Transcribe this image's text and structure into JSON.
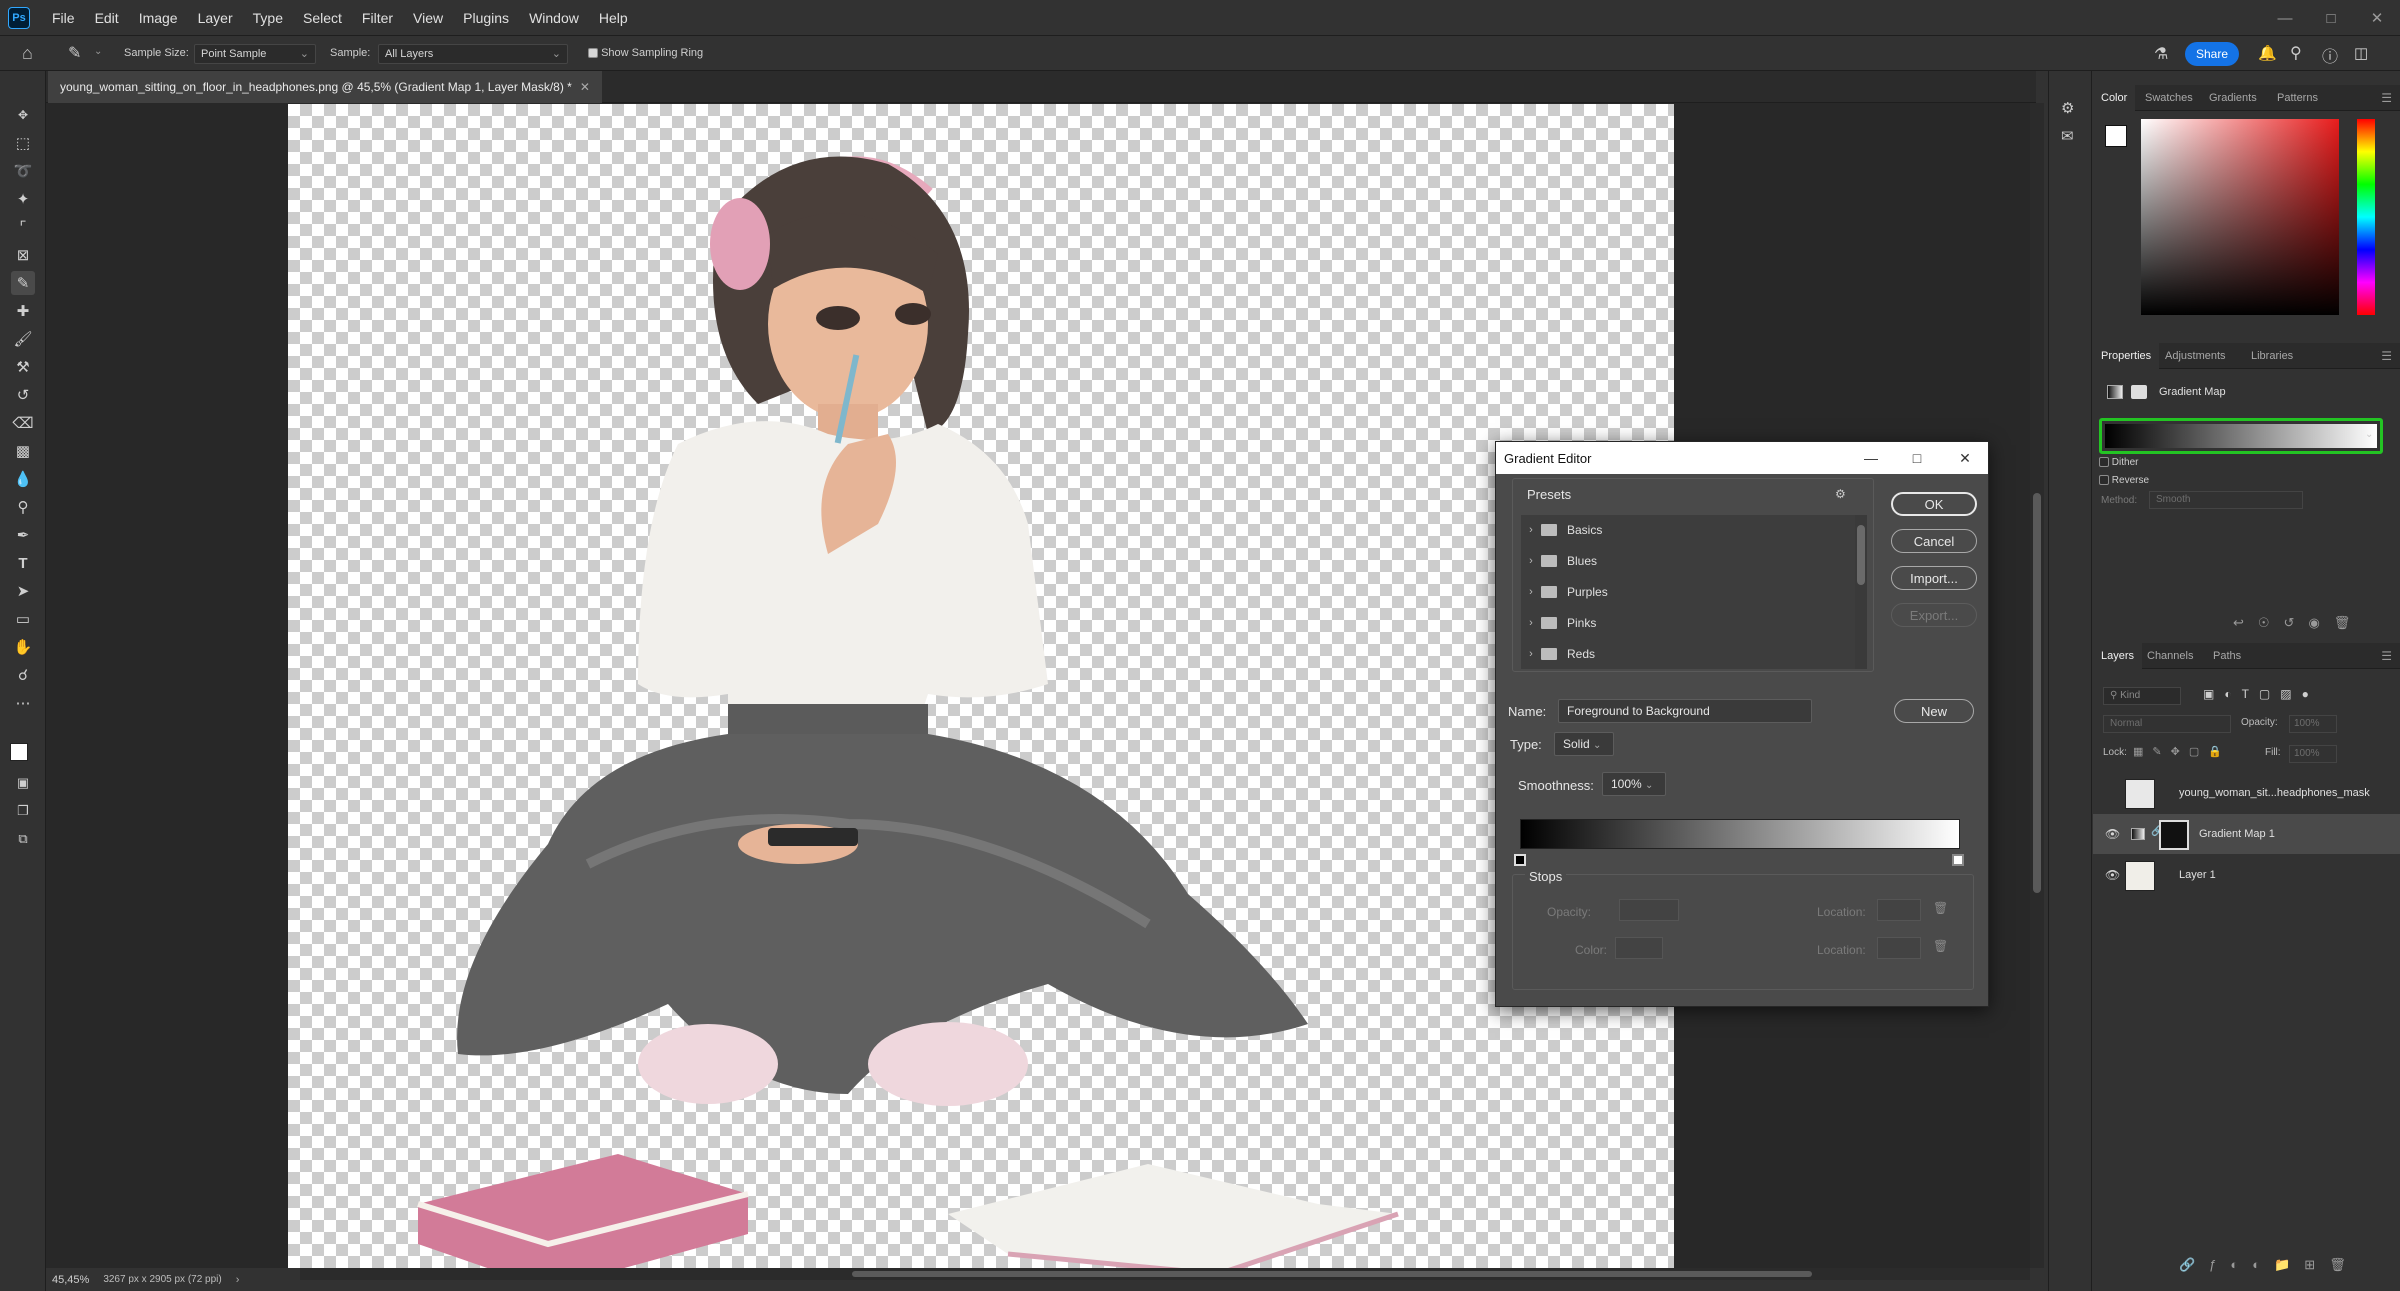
{
  "app": {
    "logo": "Ps"
  },
  "menu": [
    "File",
    "Edit",
    "Image",
    "Layer",
    "Type",
    "Select",
    "Filter",
    "View",
    "Plugins",
    "Window",
    "Help"
  ],
  "options_bar": {
    "sample_size_label": "Sample Size:",
    "sample_size_value": "Point Sample",
    "sample_label": "Sample:",
    "sample_value": "All Layers",
    "show_sampling_ring": "Show Sampling Ring",
    "share": "Share"
  },
  "document": {
    "tab_title": "young_woman_sitting_on_floor_in_headphones.png @ 45,5% (Gradient Map 1, Layer Mask/8) *",
    "zoom": "45,45%",
    "info": "3267 px x 2905 px (72 ppi)"
  },
  "color_panel": {
    "tabs": [
      "Color",
      "Swatches",
      "Gradients",
      "Patterns"
    ]
  },
  "properties_panel": {
    "tabs": [
      "Properties",
      "Adjustments",
      "Libraries"
    ],
    "title": "Gradient Map",
    "dither": "Dither",
    "reverse": "Reverse",
    "method_label": "Method:",
    "method_value": "Smooth"
  },
  "layers_panel": {
    "tabs": [
      "Layers",
      "Channels",
      "Paths"
    ],
    "kind_placeholder": "Kind",
    "blend_mode": "Normal",
    "opacity_label": "Opacity:",
    "opacity_value": "100%",
    "lock_label": "Lock:",
    "fill_label": "Fill:",
    "fill_value": "100%",
    "layers": [
      {
        "name": "young_woman_sit...headphones_mask",
        "visible": false,
        "selected": false
      },
      {
        "name": "Gradient Map 1",
        "visible": true,
        "selected": true
      },
      {
        "name": "Layer 1",
        "visible": true,
        "selected": false
      }
    ]
  },
  "gradient_editor": {
    "title": "Gradient Editor",
    "presets_label": "Presets",
    "presets": [
      "Basics",
      "Blues",
      "Purples",
      "Pinks",
      "Reds"
    ],
    "ok": "OK",
    "cancel": "Cancel",
    "import": "Import...",
    "export": "Export...",
    "name_label": "Name:",
    "name_value": "Foreground to Background",
    "new": "New",
    "type_label": "Type:",
    "type_value": "Solid",
    "smoothness_label": "Smoothness:",
    "smoothness_value": "100%",
    "stops_label": "Stops",
    "opacity_label": "Opacity:",
    "color_label": "Color:",
    "location_label_1": "Location:",
    "location_label_2": "Location:"
  }
}
